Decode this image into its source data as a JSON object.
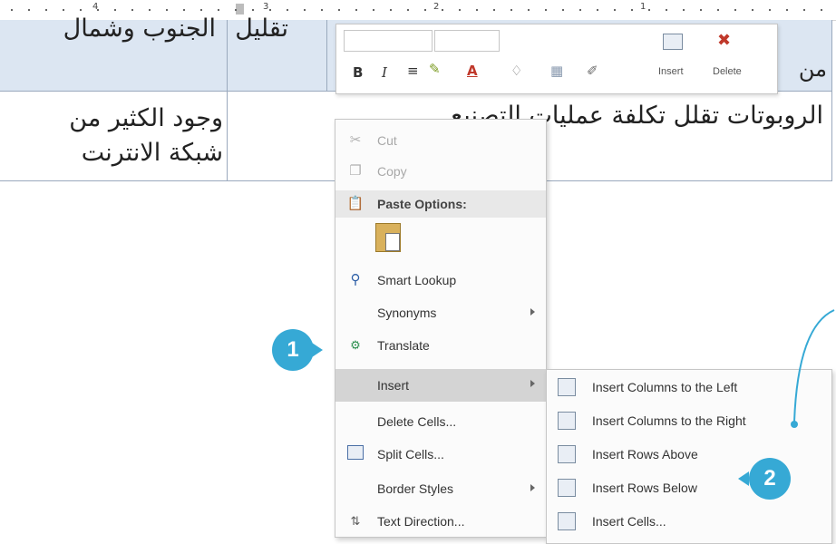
{
  "ruler": {
    "numbers": [
      "4",
      "3",
      "2",
      "1"
    ]
  },
  "table": {
    "header_cells": [
      "الجنوب وشمال",
      "تقليل",
      "من"
    ],
    "row1": {
      "col_left": "وجود الكثير من\nشبكة الانترنت",
      "col_right": "الروبوتات تقلل تكلفة عمليات التصنيع"
    }
  },
  "minibar": {
    "bold": "B",
    "italic": "I",
    "insert_label": "Insert",
    "delete_label": "Delete"
  },
  "context_menu": {
    "items": [
      {
        "label": "Cut",
        "disabled": true
      },
      {
        "label": "Copy",
        "disabled": true
      },
      {
        "label": "Paste Options:",
        "bold": true
      },
      {
        "label": "Smart Lookup"
      },
      {
        "label": "Synonyms"
      },
      {
        "label": "Translate"
      },
      {
        "label": "Insert"
      },
      {
        "label": "Delete Cells..."
      },
      {
        "label": "Split Cells..."
      },
      {
        "label": "Border Styles"
      },
      {
        "label": "Text Direction..."
      }
    ]
  },
  "submenu": {
    "items": [
      {
        "label": "Insert Columns to the Left"
      },
      {
        "label": "Insert Columns to the Right"
      },
      {
        "label": "Insert Rows Above"
      },
      {
        "label": "Insert Rows Below"
      },
      {
        "label": "Insert Cells..."
      }
    ]
  },
  "callouts": {
    "one": "1",
    "two": "2"
  },
  "colors": {
    "header_fill": "#dce6f2",
    "badge": "#36a9d5",
    "highlight": "#d4d4d4",
    "delete_red": "#c0392b"
  }
}
